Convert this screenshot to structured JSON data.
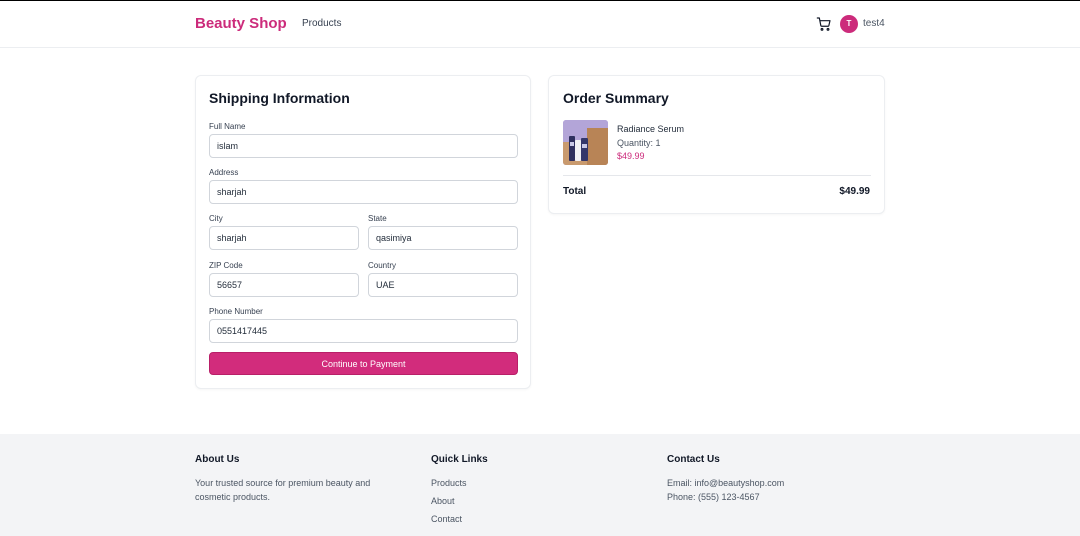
{
  "header": {
    "brand": "Beauty Shop",
    "nav_products": "Products",
    "avatar_initial": "T",
    "username": "test4",
    "cart_icon": "cart-icon"
  },
  "shipping": {
    "title": "Shipping Information",
    "full_name_label": "Full Name",
    "full_name_value": "islam",
    "address_label": "Address",
    "address_value": "sharjah",
    "city_label": "City",
    "city_value": "sharjah",
    "state_label": "State",
    "state_value": "qasimiya",
    "zip_label": "ZIP Code",
    "zip_value": "56657",
    "country_label": "Country",
    "country_value": "UAE",
    "phone_label": "Phone Number",
    "phone_value": "0551417445",
    "continue_label": "Continue to Payment"
  },
  "order": {
    "title": "Order Summary",
    "item": {
      "name": "Radiance Serum",
      "quantity": "Quantity: 1",
      "price": "$49.99"
    },
    "total_label": "Total",
    "total_value": "$49.99"
  },
  "footer": {
    "about_title": "About Us",
    "about_text_line1": "Your trusted source for premium beauty and",
    "about_text_line2": "cosmetic products.",
    "links_title": "Quick Links",
    "links": [
      "Products",
      "About",
      "Contact"
    ],
    "contact_title": "Contact Us",
    "contact_email": "Email: info@beautyshop.com",
    "contact_phone": "Phone: (555) 123-4567"
  },
  "colors": {
    "brand": "#cc2b7b",
    "button": "#d22c7c",
    "footer_bg": "#f3f4f6"
  }
}
